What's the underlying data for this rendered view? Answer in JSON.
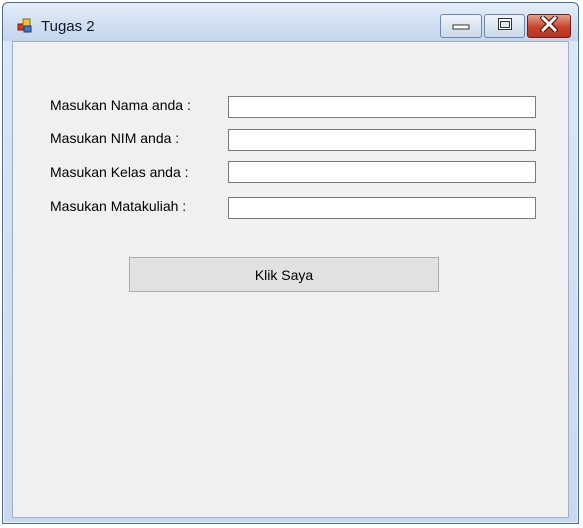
{
  "window": {
    "title": "Tugas 2",
    "icon": "app-form-icon",
    "controls": [
      "minimize-icon",
      "maximize-icon",
      "close-icon"
    ]
  },
  "form": {
    "fields": [
      {
        "label": "Masukan Nama anda :",
        "value": "",
        "placeholder": ""
      },
      {
        "label": "Masukan NIM anda :",
        "value": "",
        "placeholder": ""
      },
      {
        "label": "Masukan Kelas anda :",
        "value": "",
        "placeholder": ""
      },
      {
        "label": "Masukan Matakuliah :",
        "value": "",
        "placeholder": ""
      }
    ],
    "submit_label": "Klik Saya"
  },
  "colors": {
    "client_bg": "#f0f0f0",
    "close_button": "#c8442e",
    "titlebar": "#d3e0f2"
  }
}
